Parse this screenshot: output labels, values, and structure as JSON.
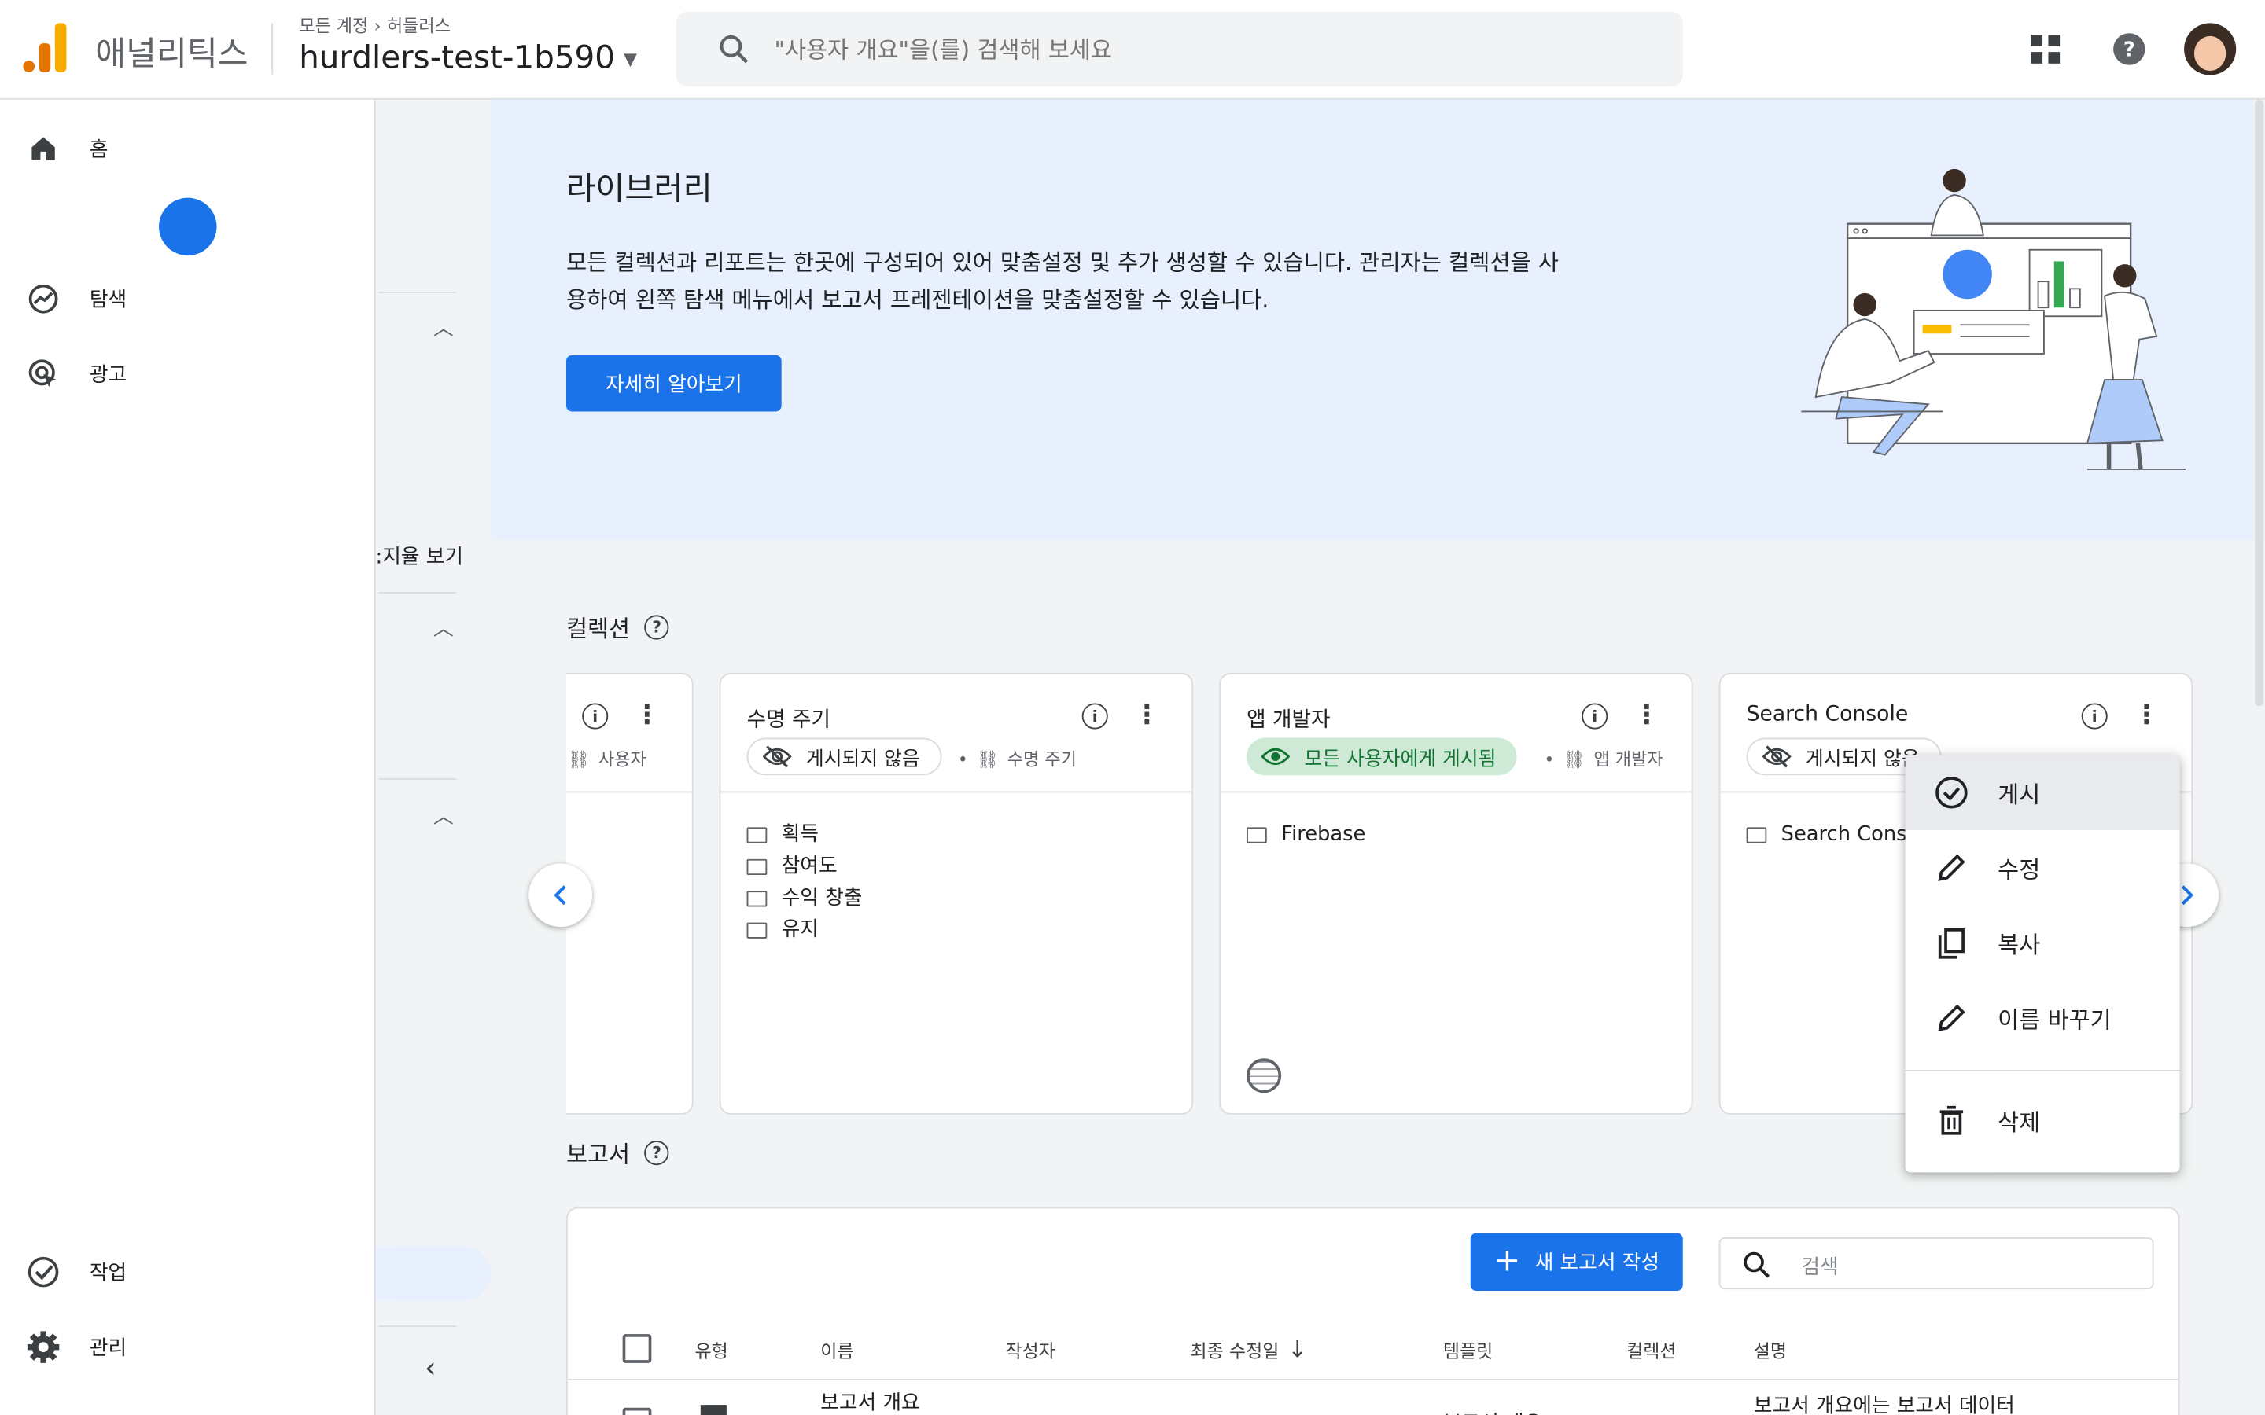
{
  "header": {
    "app_name": "애널리틱스",
    "breadcrumb_root": "모든 계정",
    "breadcrumb_account": "허들러스",
    "property_name": "hurdlers-test-1b590",
    "search_placeholder": "\"사용자 개요\"을(를) 검색해 보세요"
  },
  "nav": {
    "home": "홈",
    "explore": "탐색",
    "advertising": "광고",
    "tasks": "작업",
    "admin": "관리"
  },
  "secondary_panel": {
    "partial_text": ":지율 보기"
  },
  "banner": {
    "title": "라이브러리",
    "description": "모든 컬렉션과 리포트는 한곳에 구성되어 있어 맞춤설정 및 추가 생성할 수 있습니다. 관리자는 컬렉션을 사용하여 왼쪽 탐색 메뉴에서 보고서 프레젠테이션을 맞춤설정할 수 있습니다.",
    "learn_more": "자세히 알아보기"
  },
  "collections": {
    "title": "컬렉션",
    "help": "?",
    "cards": [
      {
        "title": "",
        "meta": "사용자",
        "folders": []
      },
      {
        "title": "수명 주기",
        "status": "게시되지 않음",
        "meta": "수명 주기",
        "folders": [
          "획득",
          "참여도",
          "수익 창출",
          "유지"
        ]
      },
      {
        "title": "앱 개발자",
        "status": "모든 사용자에게 게시됨",
        "meta": "앱 개발자",
        "folders": [
          "Firebase"
        ]
      },
      {
        "title": "Search Console",
        "status": "게시되지 않음",
        "meta": "",
        "folders": [
          "Search Console"
        ]
      }
    ]
  },
  "menu": {
    "items": [
      "게시",
      "수정",
      "복사",
      "이름 바꾸기",
      "삭제"
    ]
  },
  "reports": {
    "title": "보고서",
    "new_report": "새 보고서 작성",
    "search_placeholder": "검색",
    "columns": [
      "유형",
      "이름",
      "작성자",
      "최종 수정일",
      "템플릿",
      "컬렉션",
      "설명"
    ],
    "first_row": {
      "name": "보고서 개요",
      "template": "보고서 개요",
      "description": "보고서 개요에는 보고서 데이터"
    }
  },
  "colors": {
    "primary": "#1a73e8",
    "banner_bg": "#e8f0fe",
    "published_bg": "#ceead6",
    "published_text": "#137333"
  }
}
